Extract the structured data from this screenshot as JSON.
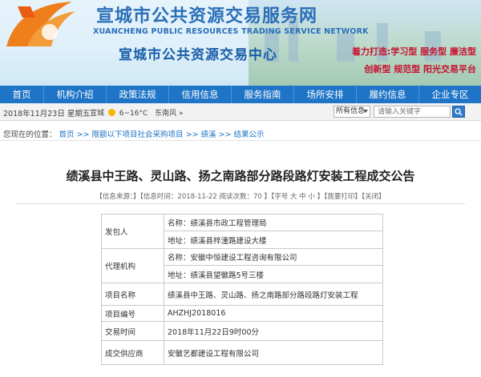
{
  "header": {
    "site_name": "宣城市公共资源交易服务网",
    "site_name_en": "XUANCHENG PUBLIC RESOURCES TRADING SERVICE NETWORK",
    "center_name": "宣城市公共资源交易中心",
    "slogan_line1": "着力打造:学习型 服务型 廉洁型",
    "slogan_line2": "创新型 规范型 阳光交易平台"
  },
  "nav": {
    "items": [
      "首页",
      "机构介绍",
      "政策法规",
      "信用信息",
      "服务指南",
      "场所安排",
      "履约信息",
      "企业专区"
    ]
  },
  "infobar": {
    "date": "2018年11月23日 星期五",
    "weather_city": "宣城",
    "weather_temp": "6~16°C",
    "weather_wind": "东南风",
    "wind_level_suffix": "»",
    "search_scope": "所有信息",
    "search_placeholder": "请输入关键字"
  },
  "breadcrumb": {
    "prefix": "您现在的位置：",
    "items": [
      "首页",
      "限额以下项目社会采购项目",
      "绩溪",
      "结果公示"
    ],
    "separator": ">>"
  },
  "article": {
    "title": "绩溪县中王路、灵山路、扬之南路部分路段路灯安装工程成交公告",
    "meta": "【信息来源：】【信息时间：2018-11-22 阅读次数：70 】【字号 大 中 小 】【我要打印】【关闭】"
  },
  "table": {
    "fabaoren_label": "发包人",
    "fabaoren_name": "名称：绩溪县市政工程管理局",
    "fabaoren_address": "地址：绩溪县梓潼路建设大楼",
    "daili_label": "代理机构",
    "daili_name": "名称：安徽中恒建设工程咨询有限公司",
    "daili_address": "地址：绩溪县望徽路5号三楼",
    "project_name_label": "项目名称",
    "project_name_value": "绩溪县中王路、灵山路、扬之南路部分路段路灯安装工程",
    "project_no_label": "项目编号",
    "project_no_value": "AHZHJ2018016",
    "trade_time_label": "交易时间",
    "trade_time_value": "2018年11月22日9时00分",
    "supplier_label": "成交供应商",
    "supplier_value": "安徽艺都建设工程有限公司"
  }
}
